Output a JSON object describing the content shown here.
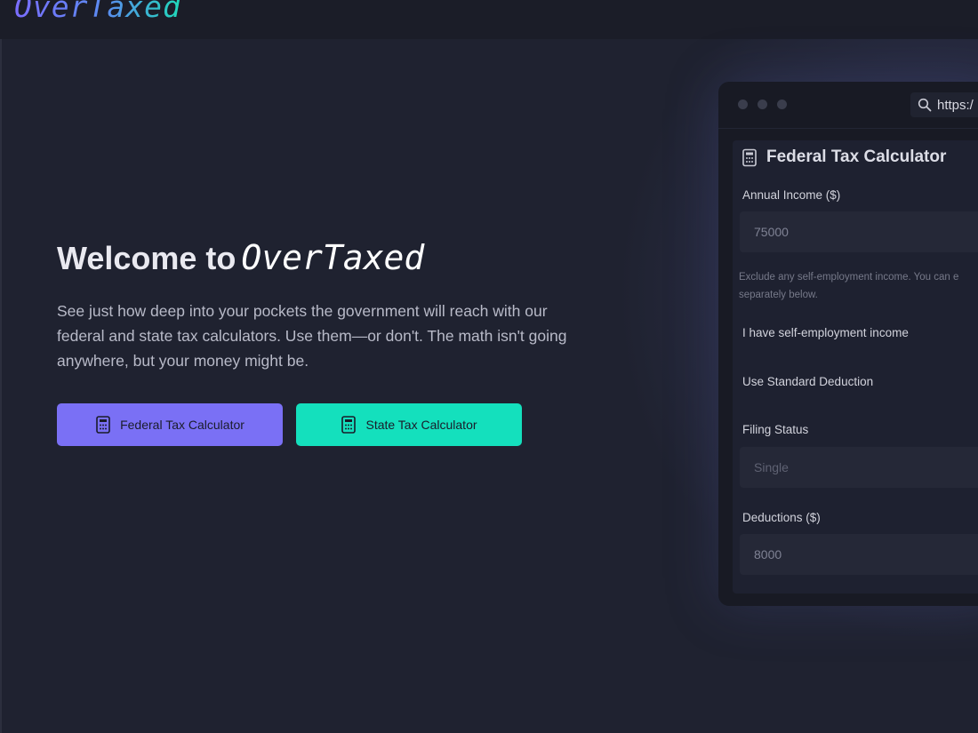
{
  "app": {
    "logo": "OverTaxed"
  },
  "hero": {
    "title_prefix": "Welcome to",
    "title_brand": "OverTaxed",
    "description": "See just how deep into your pockets the government will reach with our federal and state tax calculators. Use them—or don't. The math isn't going anywhere, but your money might be.",
    "buttons": {
      "federal": "Federal Tax Calculator",
      "state": "State Tax Calculator"
    }
  },
  "preview": {
    "url": "https:/",
    "icons": {
      "search": "search-icon",
      "calculator": "calculator-icon"
    },
    "panel": {
      "title": "Federal Tax Calculator",
      "annual_income_label": "Annual Income ($)",
      "annual_income_value": "75000",
      "hint_line1": "Exclude any self-employment income. You can e",
      "hint_line2": "separately below.",
      "self_employment_label": "I have self-employment income",
      "standard_deduction_label": "Use Standard Deduction",
      "filing_status_label": "Filing Status",
      "filing_status_value": "Single",
      "deductions_label": "Deductions ($)",
      "deductions_value": "8000"
    }
  },
  "colors": {
    "background": "#1f2230",
    "federal_button": "#7a70f5",
    "state_button": "#14e0bd",
    "logo_gradient_start": "#7b6dff",
    "logo_gradient_end": "#1fd9b8"
  }
}
